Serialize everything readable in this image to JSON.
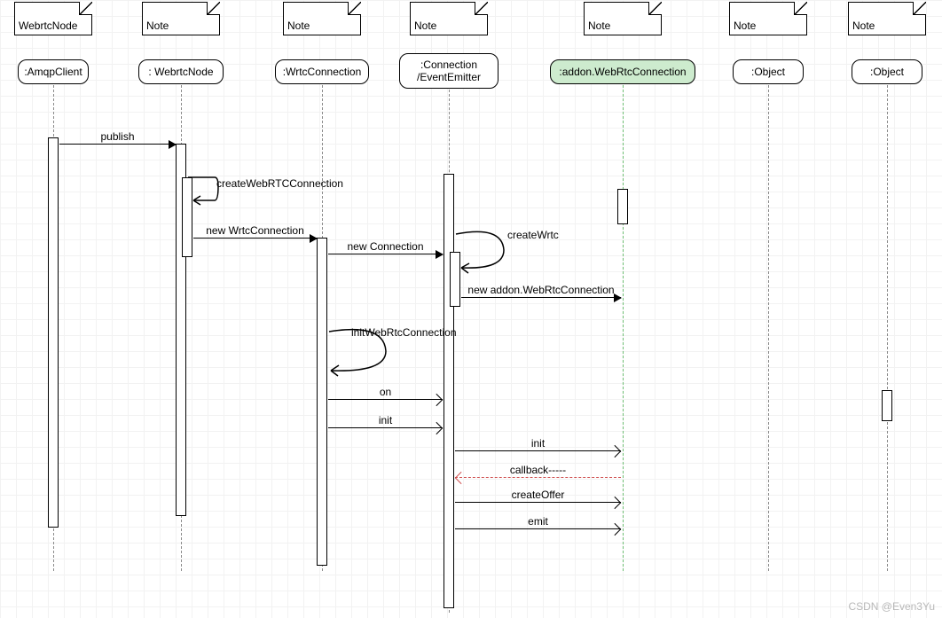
{
  "participants": [
    {
      "top_label": "WebrtcNode",
      "box_label": ":AmqpClient"
    },
    {
      "top_label": "Note",
      "box_label": ": WebrtcNode"
    },
    {
      "top_label": "Note",
      "box_label": ":WrtcConnection"
    },
    {
      "top_label": "Note",
      "box_label": ":Connection\n/EventEmitter"
    },
    {
      "top_label": "Note",
      "box_label": ":addon.WebRtcConnection"
    },
    {
      "top_label": "Note",
      "box_label": ":Object"
    },
    {
      "top_label": "Note",
      "box_label": ":Object"
    }
  ],
  "messages": {
    "publish": "publish",
    "createWebRTCConnection": "createWebRTCConnection",
    "newWrtcConnection": "new WrtcConnection",
    "newConnection": "new Connection",
    "createWrtc": "createWrtc",
    "newAddon": "new addon.WebRtcConnection",
    "initWebRtcConnection": "initWebRtcConnection",
    "on": "on",
    "init": "init",
    "init2": "init",
    "callback": "callback-----",
    "createOffer": "createOffer",
    "emit": "emit"
  },
  "watermark": "CSDN @Even3Yu",
  "chart_data": {
    "type": "sequence-diagram",
    "participants": [
      "AmqpClient",
      "WebrtcNode",
      "WrtcConnection",
      "Connection/EventEmitter",
      "addon.WebRtcConnection",
      "Object",
      "Object"
    ],
    "interactions": [
      {
        "from": "AmqpClient",
        "to": "WebrtcNode",
        "label": "publish",
        "kind": "sync"
      },
      {
        "from": "WebrtcNode",
        "to": "WebrtcNode",
        "label": "createWebRTCConnection",
        "kind": "self"
      },
      {
        "from": "WebrtcNode",
        "to": "WrtcConnection",
        "label": "new WrtcConnection",
        "kind": "sync"
      },
      {
        "from": "WrtcConnection",
        "to": "Connection/EventEmitter",
        "label": "new Connection",
        "kind": "sync"
      },
      {
        "from": "Connection/EventEmitter",
        "to": "Connection/EventEmitter",
        "label": "createWrtc",
        "kind": "self"
      },
      {
        "from": "Connection/EventEmitter",
        "to": "addon.WebRtcConnection",
        "label": "new addon.WebRtcConnection",
        "kind": "sync"
      },
      {
        "from": "WrtcConnection",
        "to": "WrtcConnection",
        "label": "initWebRtcConnection",
        "kind": "self"
      },
      {
        "from": "WrtcConnection",
        "to": "Connection/EventEmitter",
        "label": "on",
        "kind": "async"
      },
      {
        "from": "WrtcConnection",
        "to": "Connection/EventEmitter",
        "label": "init",
        "kind": "async"
      },
      {
        "from": "Connection/EventEmitter",
        "to": "addon.WebRtcConnection",
        "label": "init",
        "kind": "async"
      },
      {
        "from": "addon.WebRtcConnection",
        "to": "Connection/EventEmitter",
        "label": "callback-----",
        "kind": "return"
      },
      {
        "from": "Connection/EventEmitter",
        "to": "addon.WebRtcConnection",
        "label": "createOffer",
        "kind": "async"
      },
      {
        "from": "Connection/EventEmitter",
        "to": "addon.WebRtcConnection",
        "label": "emit",
        "kind": "async"
      }
    ]
  }
}
